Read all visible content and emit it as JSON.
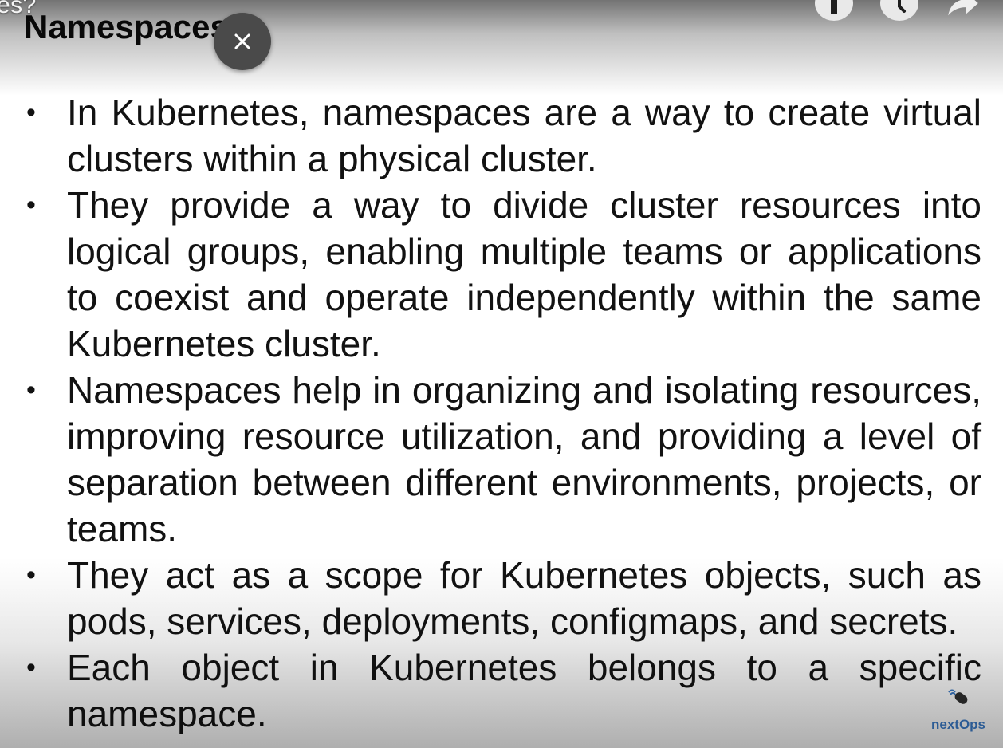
{
  "overlay": {
    "title_fragment": "es?"
  },
  "slide": {
    "title": "Namespaces",
    "bullets": [
      "In Kubernetes, namespaces are a way to create virtual clusters within a physical cluster.",
      "They provide a way to divide cluster resources into logical groups, enabling multiple teams or applications to coexist and operate independently within the same Kubernetes cluster.",
      "Namespaces help in organizing and isolating resources, improving resource utilization, and providing a level of separation between different environments, projects, or teams.",
      "They act as a scope for Kubernetes objects, such as pods, services, deployments, configmaps, and secrets.",
      "Each object in Kubernetes belongs to a specific namespace."
    ],
    "bullet_glyph": "•",
    "logo": {
      "text": "nextOps",
      "color": "#3a78c2"
    }
  },
  "controls": {
    "close_icon": "close-icon",
    "info_icon": "info-icon",
    "watch_later_icon": "clock-icon",
    "share_icon": "share-icon"
  }
}
